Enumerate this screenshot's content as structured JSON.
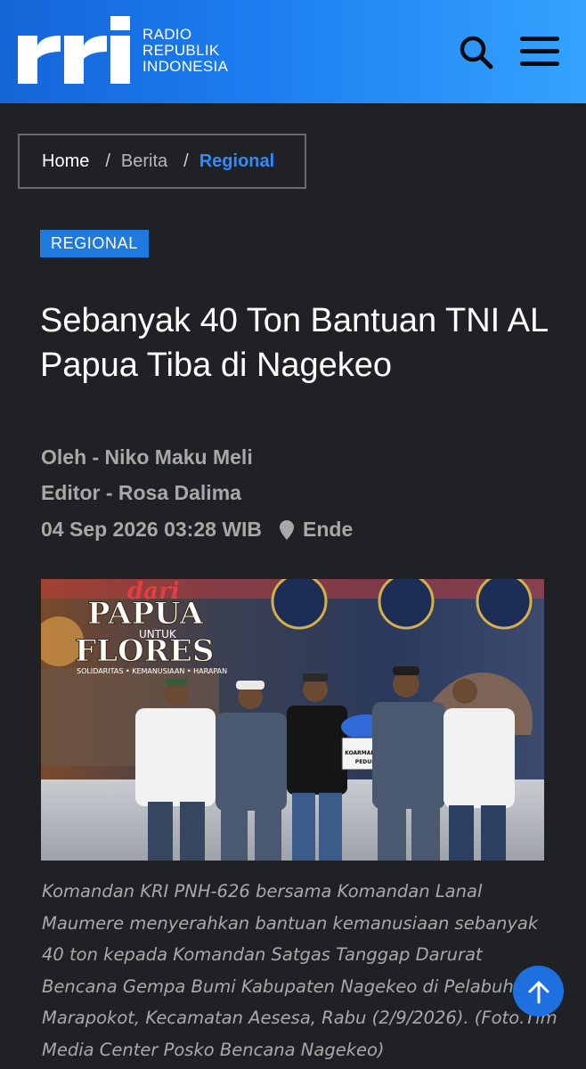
{
  "brand": {
    "logo_letters": "rri",
    "line1": "RADIO",
    "line2": "REPUBLIK",
    "line3": "INDONESIA",
    "primary_color": "#1c7ef0"
  },
  "header_icons": [
    "search-icon",
    "menu-icon"
  ],
  "breadcrumb": {
    "items": [
      "Home",
      "Berita",
      "Regional"
    ],
    "separator": "/"
  },
  "article": {
    "category": "REGIONAL",
    "title": "Sebanyak 40 Ton Bantuan TNI AL Papua Tiba di Nagekeo",
    "author": "Oleh - Niko Maku Meli",
    "editor": "Editor - Rosa Dalima",
    "datetime": "04 Sep 2026 03:28 WIB",
    "location": "Ende",
    "photo": {
      "banner_line1": "dari",
      "banner_line2": "PAPUA",
      "banner_line3": "UNTUK",
      "banner_line4": "FLORES",
      "banner_tagline": "SOLIDARITAS • KEMANUSIAAN • HARAPAN",
      "box_label1": "KOARMADA III",
      "box_label2": "PEDULI"
    },
    "caption": "Komandan KRI PNH-626 bersama Komandan Lanal Maumere menyerahkan bantuan kemanusiaan sebanyak 40 ton kepada Komandan Satgas Tanggap Darurat Bencana Gempa Bumi Kabupaten Nagekeo di Pelabuh Marapokot, Kecamatan Aesesa, Rabu (2/9/2026). (Foto.Tim Media Center Posko Bencana Nagekeo)"
  }
}
